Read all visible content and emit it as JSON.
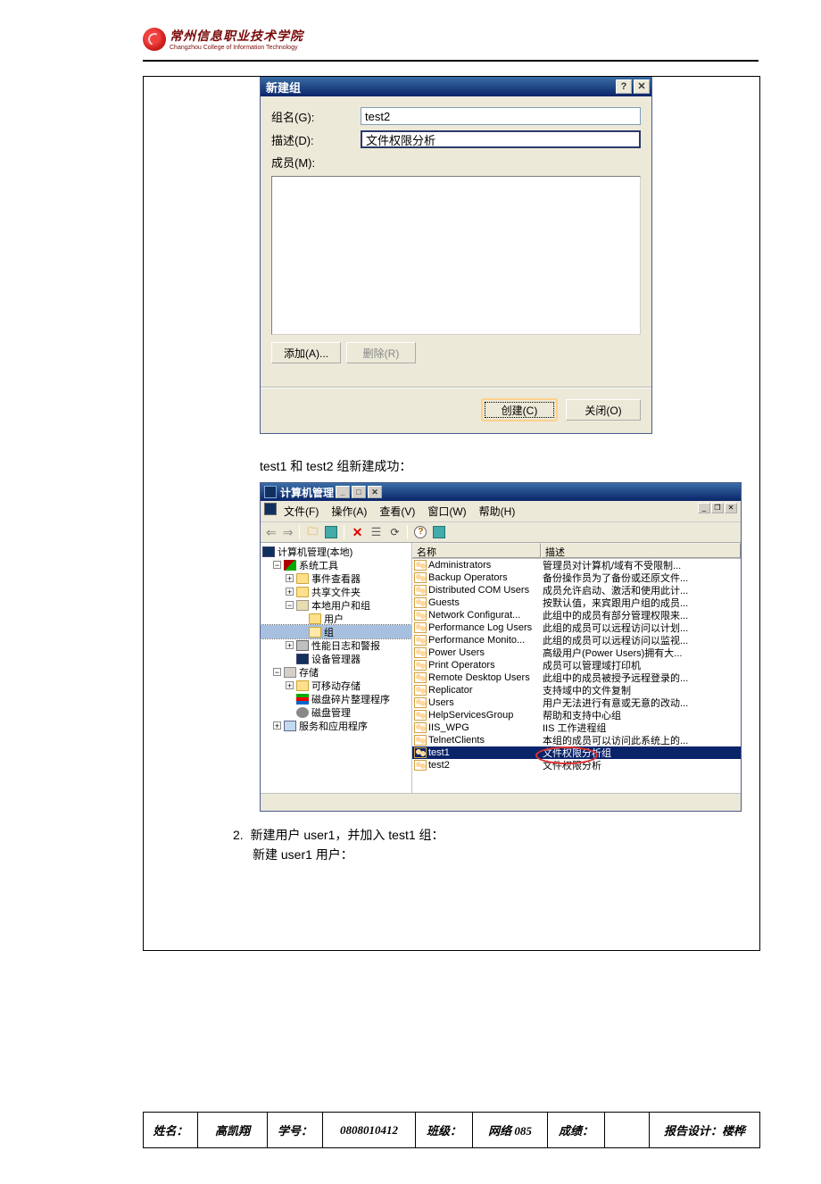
{
  "header": {
    "cn": "常州信息职业技术学院",
    "en": "Changzhou College of Information Technology"
  },
  "dialog1": {
    "title": "新建组",
    "group_label": "组名(G):",
    "group_value": "test2",
    "desc_label": "描述(D):",
    "desc_value": "文件权限分析",
    "members_label": "成员(M):",
    "add": "添加(A)...",
    "remove": "删除(R)",
    "create": "创建(C)",
    "close": "关闭(O)"
  },
  "caption1": "test1 和 test2 组新建成功：",
  "mmc": {
    "title": "计算机管理",
    "menus": {
      "file": "文件(F)",
      "action": "操作(A)",
      "view": "查看(V)",
      "window": "窗口(W)",
      "help": "帮助(H)"
    },
    "cols": {
      "name": "名称",
      "desc": "描述"
    },
    "tree": {
      "root": "计算机管理(本地)",
      "sys": "系统工具",
      "event": "事件查看器",
      "shared": "共享文件夹",
      "local": "本地用户和组",
      "users": "用户",
      "groups": "组",
      "perf": "性能日志和警报",
      "dev": "设备管理器",
      "storage": "存储",
      "removable": "可移动存储",
      "defrag": "磁盘碎片整理程序",
      "diskmgmt": "磁盘管理",
      "services": "服务和应用程序"
    },
    "rows": [
      {
        "name": "Administrators",
        "desc": "管理员对计算机/域有不受限制..."
      },
      {
        "name": "Backup Operators",
        "desc": "备份操作员为了备份或还原文件..."
      },
      {
        "name": "Distributed COM Users",
        "desc": "成员允许启动、激活和使用此计..."
      },
      {
        "name": "Guests",
        "desc": "按默认值，来宾跟用户组的成员..."
      },
      {
        "name": "Network Configurat...",
        "desc": "此组中的成员有部分管理权限来..."
      },
      {
        "name": "Performance Log Users",
        "desc": "此组的成员可以远程访问以计划..."
      },
      {
        "name": "Performance Monito...",
        "desc": "此组的成员可以远程访问以监视..."
      },
      {
        "name": "Power Users",
        "desc": "高级用户(Power Users)拥有大..."
      },
      {
        "name": "Print Operators",
        "desc": "成员可以管理域打印机"
      },
      {
        "name": "Remote Desktop Users",
        "desc": "此组中的成员被授予远程登录的..."
      },
      {
        "name": "Replicator",
        "desc": "支持域中的文件复制"
      },
      {
        "name": "Users",
        "desc": "用户无法进行有意或无意的改动..."
      },
      {
        "name": "HelpServicesGroup",
        "desc": "帮助和支持中心组"
      },
      {
        "name": "IIS_WPG",
        "desc": "IIS 工作进程组"
      },
      {
        "name": "TelnetClients",
        "desc": "本组的成员可以访问此系统上的..."
      },
      {
        "name": "test1",
        "desc": "文件权限分析组",
        "sel": true
      },
      {
        "name": "test2",
        "desc": "文件权限分析"
      }
    ]
  },
  "task": {
    "num": "2.",
    "text": "新建用户 user1，并加入 test1 组：",
    "sub": "新建 user1 用户："
  },
  "footer": {
    "name_l": "姓名：",
    "name_v": "高凯翔",
    "id_l": "学号：",
    "id_v": "0808010412",
    "class_l": "班级：",
    "class_v": "网络 085",
    "score_l": "成绩：",
    "design": "报告设计：楼桦"
  }
}
